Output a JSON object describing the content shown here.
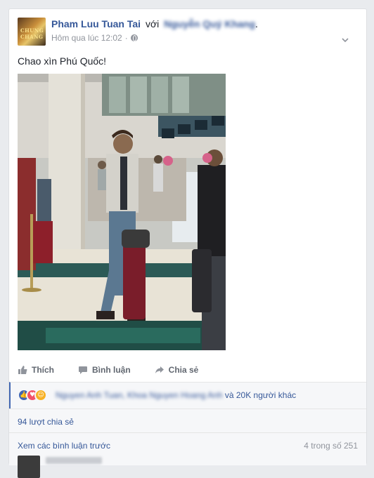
{
  "post": {
    "author": "Pham Luu Tuan Tai",
    "with_word": "với",
    "tagged_name": "Nguyễn Quý Khang",
    "tagged_suffix": ".",
    "timestamp": "Hôm qua lúc 12:02",
    "time_separator": "·",
    "privacy_icon": "globe-icon",
    "text": "Chao xìn Phú Quốc!",
    "avatar_text": "CHUNG CHANG"
  },
  "actions": {
    "like_label": "Thích",
    "comment_label": "Bình luận",
    "share_label": "Chia sẻ"
  },
  "reactions": {
    "icons": [
      "like-reaction-icon",
      "love-reaction-icon",
      "haha-reaction-icon"
    ],
    "names": "Nguyen Anh Tuan, Khoa Nguyen Hoang Anh",
    "others": "và 20K người khác"
  },
  "shares": {
    "text": "94 lượt chia sẻ"
  },
  "comments": {
    "view_previous": "Xem các bình luận trước",
    "count": "4 trong số 251"
  },
  "colors": {
    "link": "#365899",
    "meta": "#90949c",
    "background": "#e9ebee",
    "card": "#ffffff",
    "like_blue": "#4267b2"
  }
}
